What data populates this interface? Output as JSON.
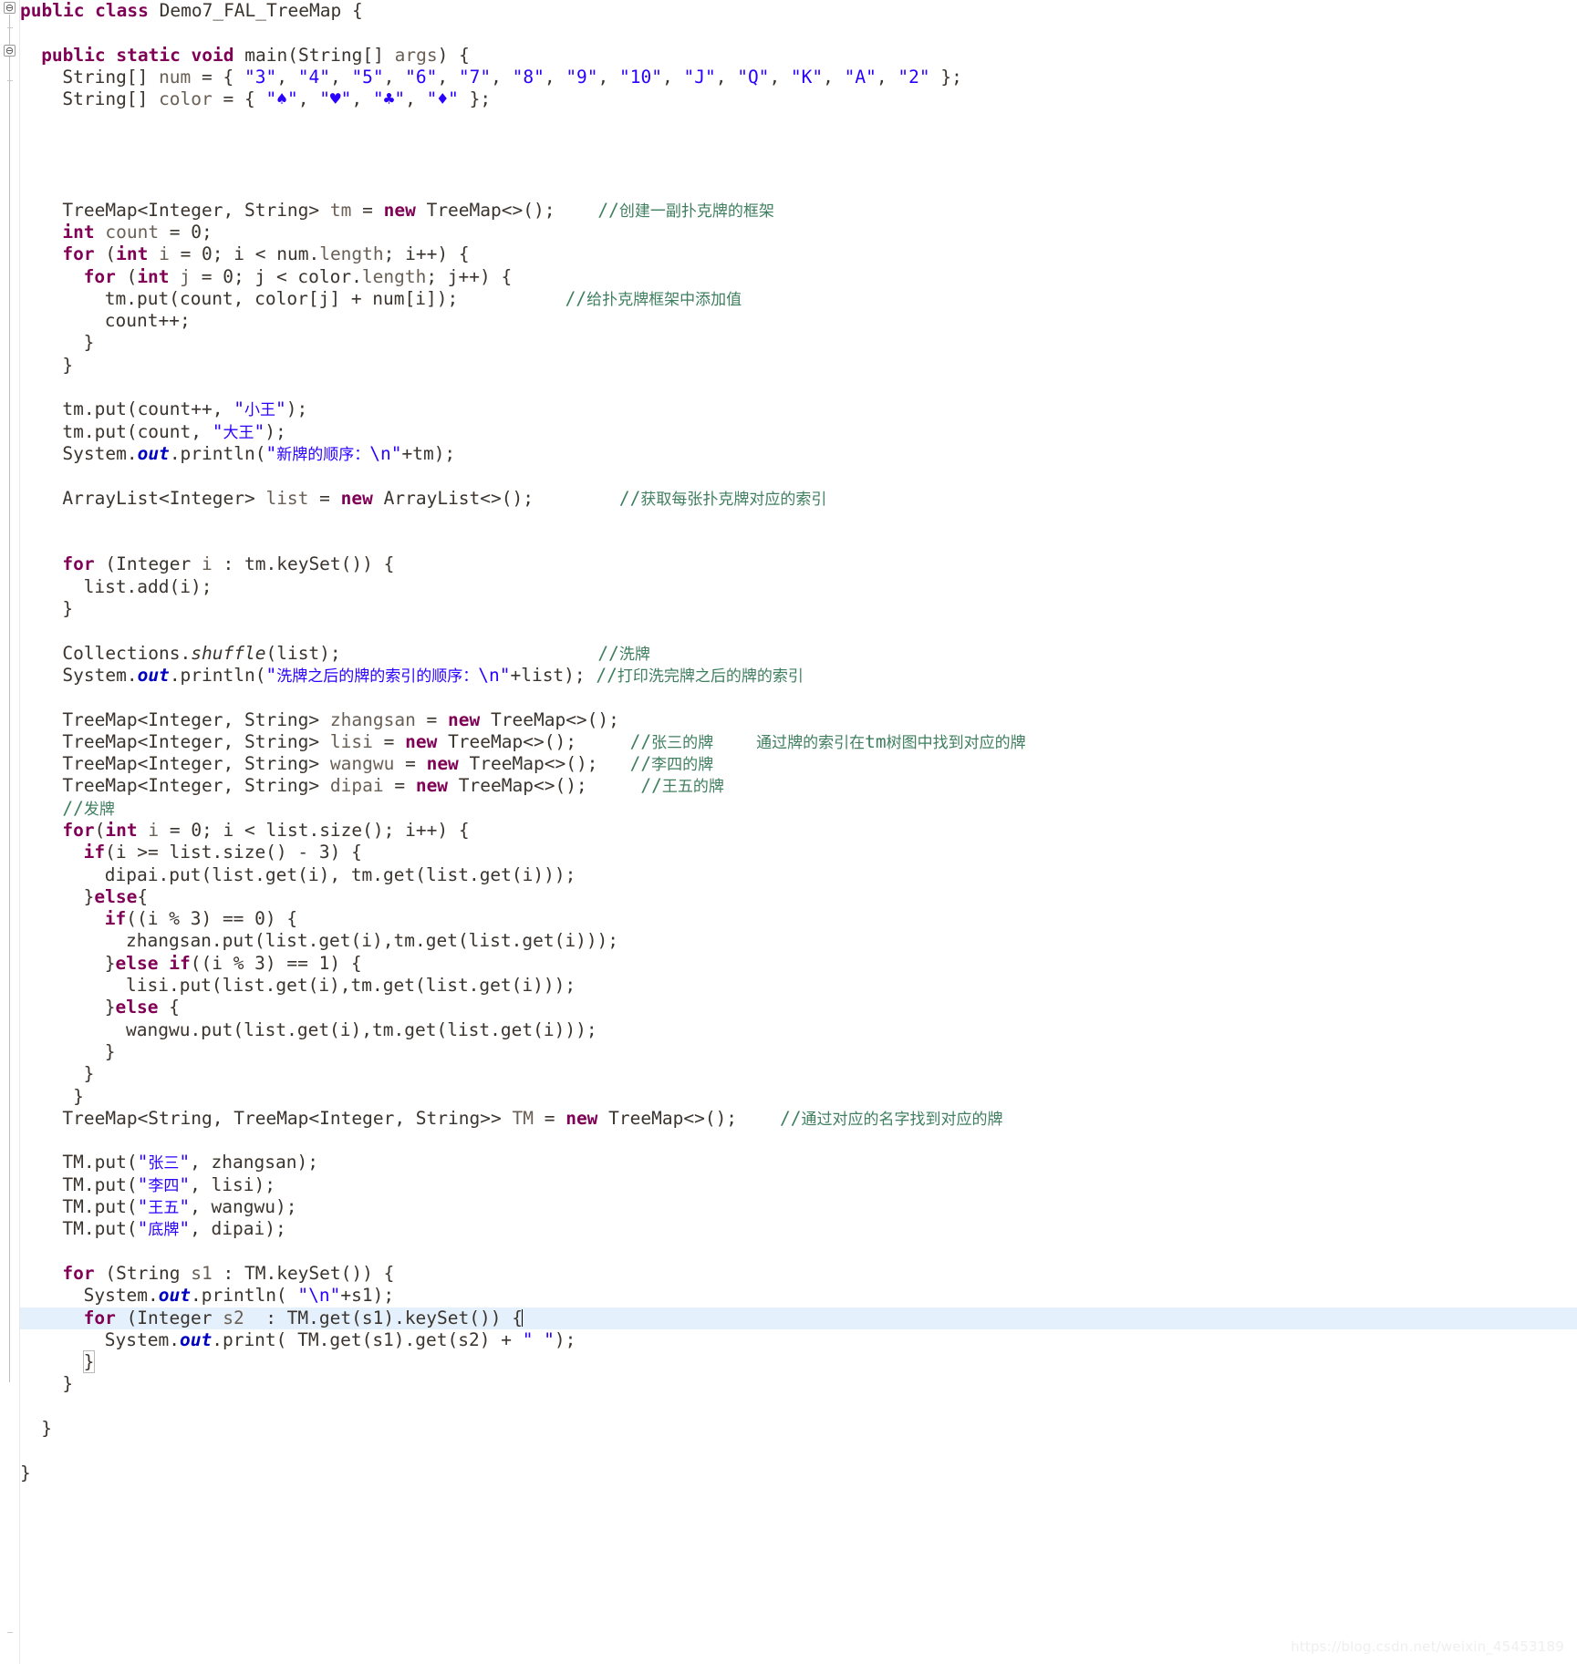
{
  "editor": {
    "language": "java",
    "class_name": "Demo7_FAL_TreeMap",
    "highlighted_line_index": 57,
    "colors": {
      "background": "#ffffff",
      "foreground": "#3b342e",
      "keyword": "#7f0055",
      "string": "#2a00ff",
      "comment": "#3f7f5f",
      "static_field": "#0000c0",
      "selection": "#e4f0fb",
      "gutter_border": "#e8e8e8"
    }
  },
  "watermark": "https://blog.csdn.net/weixin_45453189",
  "gutter": {
    "fold_markers": [
      "collapse-marker-class",
      "collapse-marker-main"
    ]
  },
  "code_lines": [
    {
      "n": 1,
      "indent": 0,
      "tokens": [
        {
          "t": "kw",
          "v": "public class "
        },
        {
          "t": "plain",
          "v": "Demo7_FAL_TreeMap {"
        }
      ]
    },
    {
      "n": 2,
      "indent": 0,
      "tokens": []
    },
    {
      "n": 3,
      "indent": 1,
      "tokens": [
        {
          "t": "kw",
          "v": "public static void "
        },
        {
          "t": "plain",
          "v": "main("
        },
        {
          "t": "plain",
          "v": "String[] "
        },
        {
          "t": "param",
          "v": "args"
        },
        {
          "t": "plain",
          "v": ") {"
        }
      ]
    },
    {
      "n": 4,
      "indent": 2,
      "tokens": [
        {
          "t": "plain",
          "v": "String[] "
        },
        {
          "t": "param",
          "v": "num"
        },
        {
          "t": "plain",
          "v": " = { "
        },
        {
          "t": "str",
          "v": "\"3\""
        },
        {
          "t": "plain",
          "v": ", "
        },
        {
          "t": "str",
          "v": "\"4\""
        },
        {
          "t": "plain",
          "v": ", "
        },
        {
          "t": "str",
          "v": "\"5\""
        },
        {
          "t": "plain",
          "v": ", "
        },
        {
          "t": "str",
          "v": "\"6\""
        },
        {
          "t": "plain",
          "v": ", "
        },
        {
          "t": "str",
          "v": "\"7\""
        },
        {
          "t": "plain",
          "v": ", "
        },
        {
          "t": "str",
          "v": "\"8\""
        },
        {
          "t": "plain",
          "v": ", "
        },
        {
          "t": "str",
          "v": "\"9\""
        },
        {
          "t": "plain",
          "v": ", "
        },
        {
          "t": "str",
          "v": "\"10\""
        },
        {
          "t": "plain",
          "v": ", "
        },
        {
          "t": "str",
          "v": "\"J\""
        },
        {
          "t": "plain",
          "v": ", "
        },
        {
          "t": "str",
          "v": "\"Q\""
        },
        {
          "t": "plain",
          "v": ", "
        },
        {
          "t": "str",
          "v": "\"K\""
        },
        {
          "t": "plain",
          "v": ", "
        },
        {
          "t": "str",
          "v": "\"A\""
        },
        {
          "t": "plain",
          "v": ", "
        },
        {
          "t": "str",
          "v": "\"2\""
        },
        {
          "t": "plain",
          "v": " };"
        }
      ]
    },
    {
      "n": 5,
      "indent": 2,
      "tokens": [
        {
          "t": "plain",
          "v": "String[] "
        },
        {
          "t": "param",
          "v": "color"
        },
        {
          "t": "plain",
          "v": " = { "
        },
        {
          "t": "str",
          "v": "\"♠\""
        },
        {
          "t": "plain",
          "v": ", "
        },
        {
          "t": "str",
          "v": "\"♥\""
        },
        {
          "t": "plain",
          "v": ", "
        },
        {
          "t": "str",
          "v": "\"♣\""
        },
        {
          "t": "plain",
          "v": ", "
        },
        {
          "t": "str",
          "v": "\"♦\""
        },
        {
          "t": "plain",
          "v": " };"
        }
      ]
    },
    {
      "n": 6,
      "indent": 0,
      "tokens": []
    },
    {
      "n": 7,
      "indent": 0,
      "tokens": []
    },
    {
      "n": 8,
      "indent": 0,
      "tokens": []
    },
    {
      "n": 9,
      "indent": 0,
      "tokens": []
    },
    {
      "n": 10,
      "indent": 2,
      "tokens": [
        {
          "t": "plain",
          "v": "TreeMap<Integer, String> "
        },
        {
          "t": "param",
          "v": "tm"
        },
        {
          "t": "plain",
          "v": " = "
        },
        {
          "t": "kw",
          "v": "new "
        },
        {
          "t": "plain",
          "v": "TreeMap<>();    "
        },
        {
          "t": "cmt",
          "v": "//创建一副扑克牌的框架"
        }
      ]
    },
    {
      "n": 11,
      "indent": 2,
      "tokens": [
        {
          "t": "kw",
          "v": "int "
        },
        {
          "t": "param",
          "v": "count"
        },
        {
          "t": "plain",
          "v": " = 0;"
        }
      ]
    },
    {
      "n": 12,
      "indent": 2,
      "tokens": [
        {
          "t": "kw",
          "v": "for "
        },
        {
          "t": "plain",
          "v": "("
        },
        {
          "t": "kw",
          "v": "int "
        },
        {
          "t": "param",
          "v": "i"
        },
        {
          "t": "plain",
          "v": " = 0; i < num."
        },
        {
          "t": "param",
          "v": "length"
        },
        {
          "t": "plain",
          "v": "; i++) {"
        }
      ]
    },
    {
      "n": 13,
      "indent": 3,
      "tokens": [
        {
          "t": "kw",
          "v": "for "
        },
        {
          "t": "plain",
          "v": "("
        },
        {
          "t": "kw",
          "v": "int "
        },
        {
          "t": "param",
          "v": "j"
        },
        {
          "t": "plain",
          "v": " = 0; j < color."
        },
        {
          "t": "param",
          "v": "length"
        },
        {
          "t": "plain",
          "v": "; j++) {"
        }
      ]
    },
    {
      "n": 14,
      "indent": 4,
      "tokens": [
        {
          "t": "plain",
          "v": "tm.put(count, color[j] + num[i]);          "
        },
        {
          "t": "cmt",
          "v": "//给扑克牌框架中添加值"
        }
      ]
    },
    {
      "n": 15,
      "indent": 4,
      "tokens": [
        {
          "t": "plain",
          "v": "count++;"
        }
      ]
    },
    {
      "n": 16,
      "indent": 3,
      "tokens": [
        {
          "t": "plain",
          "v": "}"
        }
      ]
    },
    {
      "n": 17,
      "indent": 2,
      "tokens": [
        {
          "t": "plain",
          "v": "}"
        }
      ]
    },
    {
      "n": 18,
      "indent": 0,
      "tokens": []
    },
    {
      "n": 19,
      "indent": 2,
      "tokens": [
        {
          "t": "plain",
          "v": "tm.put(count++, "
        },
        {
          "t": "str",
          "v": "\"小王\""
        },
        {
          "t": "plain",
          "v": ");"
        }
      ]
    },
    {
      "n": 20,
      "indent": 2,
      "tokens": [
        {
          "t": "plain",
          "v": "tm.put(count, "
        },
        {
          "t": "str",
          "v": "\"大王\""
        },
        {
          "t": "plain",
          "v": ");"
        }
      ]
    },
    {
      "n": 21,
      "indent": 2,
      "tokens": [
        {
          "t": "plain",
          "v": "System."
        },
        {
          "t": "fld",
          "v": "out"
        },
        {
          "t": "plain",
          "v": ".println("
        },
        {
          "t": "str",
          "v": "\"新牌的顺序：\\n\""
        },
        {
          "t": "plain",
          "v": "+tm);"
        }
      ]
    },
    {
      "n": 22,
      "indent": 0,
      "tokens": []
    },
    {
      "n": 23,
      "indent": 2,
      "tokens": [
        {
          "t": "plain",
          "v": "ArrayList<Integer> "
        },
        {
          "t": "param",
          "v": "list"
        },
        {
          "t": "plain",
          "v": " = "
        },
        {
          "t": "kw",
          "v": "new "
        },
        {
          "t": "plain",
          "v": "ArrayList<>();        "
        },
        {
          "t": "cmt",
          "v": "//获取每张扑克牌对应的索引"
        }
      ]
    },
    {
      "n": 24,
      "indent": 0,
      "tokens": []
    },
    {
      "n": 25,
      "indent": 0,
      "tokens": []
    },
    {
      "n": 26,
      "indent": 2,
      "tokens": [
        {
          "t": "kw",
          "v": "for "
        },
        {
          "t": "plain",
          "v": "(Integer "
        },
        {
          "t": "param",
          "v": "i"
        },
        {
          "t": "plain",
          "v": " : tm.keySet()) {"
        }
      ]
    },
    {
      "n": 27,
      "indent": 3,
      "tokens": [
        {
          "t": "plain",
          "v": "list.add(i);"
        }
      ]
    },
    {
      "n": 28,
      "indent": 2,
      "tokens": [
        {
          "t": "plain",
          "v": "}"
        }
      ]
    },
    {
      "n": 29,
      "indent": 0,
      "tokens": []
    },
    {
      "n": 30,
      "indent": 2,
      "tokens": [
        {
          "t": "plain",
          "v": "Collections."
        },
        {
          "t": "mth",
          "v": "shuffle"
        },
        {
          "t": "plain",
          "v": "(list);                        "
        },
        {
          "t": "cmt",
          "v": "//洗牌"
        }
      ]
    },
    {
      "n": 31,
      "indent": 2,
      "tokens": [
        {
          "t": "plain",
          "v": "System."
        },
        {
          "t": "fld",
          "v": "out"
        },
        {
          "t": "plain",
          "v": ".println("
        },
        {
          "t": "str",
          "v": "\"洗牌之后的牌的索引的顺序：\\n\""
        },
        {
          "t": "plain",
          "v": "+list); "
        },
        {
          "t": "cmt",
          "v": "//打印洗完牌之后的牌的索引"
        }
      ]
    },
    {
      "n": 32,
      "indent": 0,
      "tokens": []
    },
    {
      "n": 33,
      "indent": 2,
      "tokens": [
        {
          "t": "plain",
          "v": "TreeMap<Integer, String> "
        },
        {
          "t": "param",
          "v": "zhangsan"
        },
        {
          "t": "plain",
          "v": " = "
        },
        {
          "t": "kw",
          "v": "new "
        },
        {
          "t": "plain",
          "v": "TreeMap<>();"
        }
      ]
    },
    {
      "n": 34,
      "indent": 2,
      "tokens": [
        {
          "t": "plain",
          "v": "TreeMap<Integer, String> "
        },
        {
          "t": "param",
          "v": "lisi"
        },
        {
          "t": "plain",
          "v": " = "
        },
        {
          "t": "kw",
          "v": "new "
        },
        {
          "t": "plain",
          "v": "TreeMap<>();     "
        },
        {
          "t": "cmt",
          "v": "//张三的牌"
        },
        {
          "t": "plain",
          "v": "    "
        },
        {
          "t": "cmt",
          "v": "通过牌的索引在tm树图中找到对应的牌"
        }
      ]
    },
    {
      "n": 35,
      "indent": 2,
      "tokens": [
        {
          "t": "plain",
          "v": "TreeMap<Integer, String> "
        },
        {
          "t": "param",
          "v": "wangwu"
        },
        {
          "t": "plain",
          "v": " = "
        },
        {
          "t": "kw",
          "v": "new "
        },
        {
          "t": "plain",
          "v": "TreeMap<>();   "
        },
        {
          "t": "cmt",
          "v": "//李四的牌"
        }
      ]
    },
    {
      "n": 36,
      "indent": 2,
      "tokens": [
        {
          "t": "plain",
          "v": "TreeMap<Integer, String> "
        },
        {
          "t": "param",
          "v": "dipai"
        },
        {
          "t": "plain",
          "v": " = "
        },
        {
          "t": "kw",
          "v": "new "
        },
        {
          "t": "plain",
          "v": "TreeMap<>();     "
        },
        {
          "t": "cmt",
          "v": "//王五的牌"
        }
      ]
    },
    {
      "n": 37,
      "indent": 2,
      "tokens": [
        {
          "t": "cmt",
          "v": "//发牌"
        }
      ]
    },
    {
      "n": 38,
      "indent": 2,
      "tokens": [
        {
          "t": "kw",
          "v": "for"
        },
        {
          "t": "plain",
          "v": "("
        },
        {
          "t": "kw",
          "v": "int "
        },
        {
          "t": "param",
          "v": "i"
        },
        {
          "t": "plain",
          "v": " = 0; i < list.size(); i++) {"
        }
      ]
    },
    {
      "n": 39,
      "indent": 3,
      "tokens": [
        {
          "t": "kw",
          "v": "if"
        },
        {
          "t": "plain",
          "v": "(i >= list.size() - 3) {"
        }
      ]
    },
    {
      "n": 40,
      "indent": 4,
      "tokens": [
        {
          "t": "plain",
          "v": "dipai.put(list.get(i), tm.get(list.get(i)));"
        }
      ]
    },
    {
      "n": 41,
      "indent": 3,
      "tokens": [
        {
          "t": "plain",
          "v": "}"
        },
        {
          "t": "kw",
          "v": "else"
        },
        {
          "t": "plain",
          "v": "{"
        }
      ]
    },
    {
      "n": 42,
      "indent": 4,
      "tokens": [
        {
          "t": "kw",
          "v": "if"
        },
        {
          "t": "plain",
          "v": "((i % 3) == 0) {"
        }
      ]
    },
    {
      "n": 43,
      "indent": 5,
      "tokens": [
        {
          "t": "plain",
          "v": "zhangsan.put(list.get(i),tm.get(list.get(i)));"
        }
      ]
    },
    {
      "n": 44,
      "indent": 4,
      "tokens": [
        {
          "t": "plain",
          "v": "}"
        },
        {
          "t": "kw",
          "v": "else if"
        },
        {
          "t": "plain",
          "v": "((i % 3) == 1) {"
        }
      ]
    },
    {
      "n": 45,
      "indent": 5,
      "tokens": [
        {
          "t": "plain",
          "v": "lisi.put(list.get(i),tm.get(list.get(i)));"
        }
      ]
    },
    {
      "n": 46,
      "indent": 4,
      "tokens": [
        {
          "t": "plain",
          "v": "}"
        },
        {
          "t": "kw",
          "v": "else"
        },
        {
          "t": "plain",
          "v": " {"
        }
      ]
    },
    {
      "n": 47,
      "indent": 5,
      "tokens": [
        {
          "t": "plain",
          "v": "wangwu.put(list.get(i),tm.get(list.get(i)));"
        }
      ]
    },
    {
      "n": 48,
      "indent": 4,
      "tokens": [
        {
          "t": "plain",
          "v": "}"
        }
      ]
    },
    {
      "n": 49,
      "indent": 3,
      "tokens": [
        {
          "t": "plain",
          "v": "}"
        }
      ]
    },
    {
      "n": 50,
      "indent": 2,
      "tokens": [
        {
          "t": "plain",
          "v": " }"
        }
      ]
    },
    {
      "n": 51,
      "indent": 2,
      "tokens": [
        {
          "t": "plain",
          "v": "TreeMap<String, TreeMap<Integer, String>> "
        },
        {
          "t": "param",
          "v": "TM"
        },
        {
          "t": "plain",
          "v": " = "
        },
        {
          "t": "kw",
          "v": "new "
        },
        {
          "t": "plain",
          "v": "TreeMap<>();    "
        },
        {
          "t": "cmt",
          "v": "//通过对应的名字找到对应的牌"
        }
      ]
    },
    {
      "n": 52,
      "indent": 0,
      "tokens": []
    },
    {
      "n": 53,
      "indent": 2,
      "tokens": [
        {
          "t": "plain",
          "v": "TM.put("
        },
        {
          "t": "str",
          "v": "\"张三\""
        },
        {
          "t": "plain",
          "v": ", zhangsan);"
        }
      ]
    },
    {
      "n": 54,
      "indent": 2,
      "tokens": [
        {
          "t": "plain",
          "v": "TM.put("
        },
        {
          "t": "str",
          "v": "\"李四\""
        },
        {
          "t": "plain",
          "v": ", lisi);"
        }
      ]
    },
    {
      "n": 55,
      "indent": 2,
      "tokens": [
        {
          "t": "plain",
          "v": "TM.put("
        },
        {
          "t": "str",
          "v": "\"王五\""
        },
        {
          "t": "plain",
          "v": ", wangwu);"
        }
      ]
    },
    {
      "n": 56,
      "indent": 2,
      "tokens": [
        {
          "t": "plain",
          "v": "TM.put("
        },
        {
          "t": "str",
          "v": "\"底牌\""
        },
        {
          "t": "plain",
          "v": ", dipai);"
        }
      ]
    },
    {
      "n": 57,
      "indent": 0,
      "tokens": []
    },
    {
      "n": 58,
      "indent": 2,
      "tokens": [
        {
          "t": "kw",
          "v": "for "
        },
        {
          "t": "plain",
          "v": "(String "
        },
        {
          "t": "param",
          "v": "s1"
        },
        {
          "t": "plain",
          "v": " : TM.keySet()) {"
        }
      ]
    },
    {
      "n": 59,
      "indent": 3,
      "tokens": [
        {
          "t": "plain",
          "v": "System."
        },
        {
          "t": "fld",
          "v": "out"
        },
        {
          "t": "plain",
          "v": ".println( "
        },
        {
          "t": "str",
          "v": "\"\\n\""
        },
        {
          "t": "plain",
          "v": "+s1);"
        }
      ]
    },
    {
      "n": 60,
      "indent": 3,
      "tokens": [
        {
          "t": "kw",
          "v": "for "
        },
        {
          "t": "plain",
          "v": "(Integer "
        },
        {
          "t": "param",
          "v": "s2"
        },
        {
          "t": "plain",
          "v": "  : TM.get(s1).keySet()) {"
        }
      ],
      "caret_at_end": true
    },
    {
      "n": 61,
      "indent": 4,
      "tokens": [
        {
          "t": "plain",
          "v": "System."
        },
        {
          "t": "fld",
          "v": "out"
        },
        {
          "t": "plain",
          "v": ".print( TM.get(s1).get(s2) + "
        },
        {
          "t": "str",
          "v": "\" \""
        },
        {
          "t": "plain",
          "v": ");"
        }
      ]
    },
    {
      "n": 62,
      "indent": 3,
      "tokens": [
        {
          "t": "plain",
          "v": "}"
        }
      ],
      "brace_match": true
    },
    {
      "n": 63,
      "indent": 2,
      "tokens": [
        {
          "t": "plain",
          "v": "}"
        }
      ]
    },
    {
      "n": 64,
      "indent": 0,
      "tokens": []
    },
    {
      "n": 65,
      "indent": 1,
      "tokens": [
        {
          "t": "plain",
          "v": "}"
        }
      ]
    },
    {
      "n": 66,
      "indent": 0,
      "tokens": []
    },
    {
      "n": 67,
      "indent": 0,
      "tokens": [
        {
          "t": "plain",
          "v": "}"
        }
      ]
    }
  ]
}
